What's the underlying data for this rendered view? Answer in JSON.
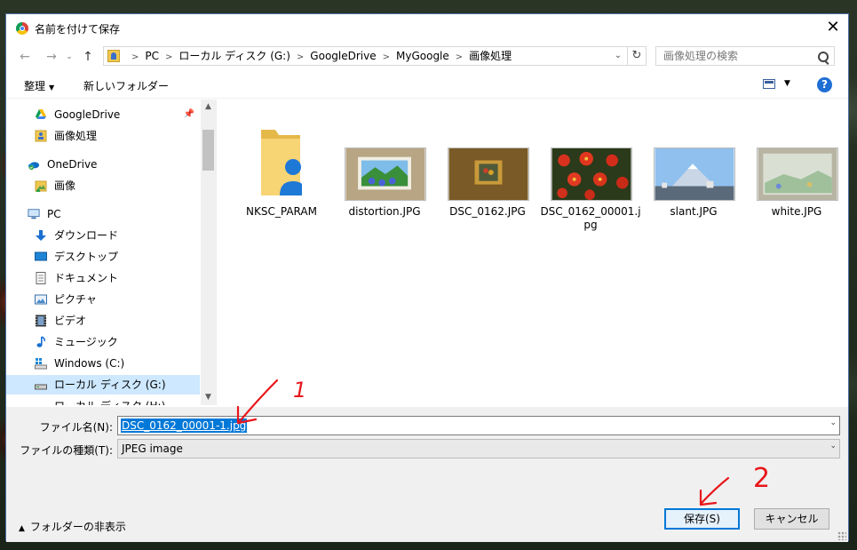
{
  "window": {
    "title": "名前を付けて保存",
    "close_glyph": "✕"
  },
  "nav_buttons": {
    "back": "←",
    "forward": "→",
    "up": "↑"
  },
  "address": {
    "crumbs": [
      "PC",
      "ローカル ディスク (G:)",
      "GoogleDrive",
      "MyGoogle",
      "画像処理"
    ],
    "separator": ">"
  },
  "search": {
    "placeholder": "画像処理の検索"
  },
  "toolbar": {
    "organize": "整理",
    "new_folder": "新しいフォルダー"
  },
  "nav_pane": {
    "items": [
      {
        "label": "GoogleDrive",
        "icon": "google-drive-icon"
      },
      {
        "label": "画像処理",
        "icon": "folder-user-icon"
      },
      {
        "label": "OneDrive",
        "icon": "onedrive-icon"
      },
      {
        "label": "画像",
        "icon": "pictures-folder-icon"
      },
      {
        "label": "PC",
        "icon": "computer-icon"
      },
      {
        "label": "ダウンロード",
        "icon": "download-arrow-icon"
      },
      {
        "label": "デスクトップ",
        "icon": "desktop-icon"
      },
      {
        "label": "ドキュメント",
        "icon": "document-icon"
      },
      {
        "label": "ピクチャ",
        "icon": "picture-icon"
      },
      {
        "label": "ビデオ",
        "icon": "video-icon"
      },
      {
        "label": "ミュージック",
        "icon": "music-note-icon"
      },
      {
        "label": "Windows (C:)",
        "icon": "windows-drive-icon"
      },
      {
        "label": "ローカル ディスク (G:)",
        "icon": "drive-icon"
      },
      {
        "label": "ローカル ディスク (H:)",
        "icon": "drive-icon"
      }
    ]
  },
  "files": [
    {
      "name": "NKSC_PARAM",
      "kind": "folder"
    },
    {
      "name": "distortion.JPG",
      "kind": "image"
    },
    {
      "name": "DSC_0162.JPG",
      "kind": "image"
    },
    {
      "name": "DSC_0162_00001.jpg",
      "kind": "image"
    },
    {
      "name": "slant.JPG",
      "kind": "image"
    },
    {
      "name": "white.JPG",
      "kind": "image"
    }
  ],
  "save_form": {
    "filename_label": "ファイル名(N):",
    "filename_value": "DSC_0162_00001-1.jpg",
    "filetype_label": "ファイルの種類(T):",
    "filetype_value": "JPEG image",
    "hide_folders": "フォルダーの非表示",
    "save_button": "保存(S)",
    "cancel_button": "キャンセル"
  },
  "annotations": {
    "step1": "1",
    "step2": "2",
    "color": "#e8161b"
  },
  "colors": {
    "accent": "#0078d7",
    "selection": "#cde8ff"
  }
}
